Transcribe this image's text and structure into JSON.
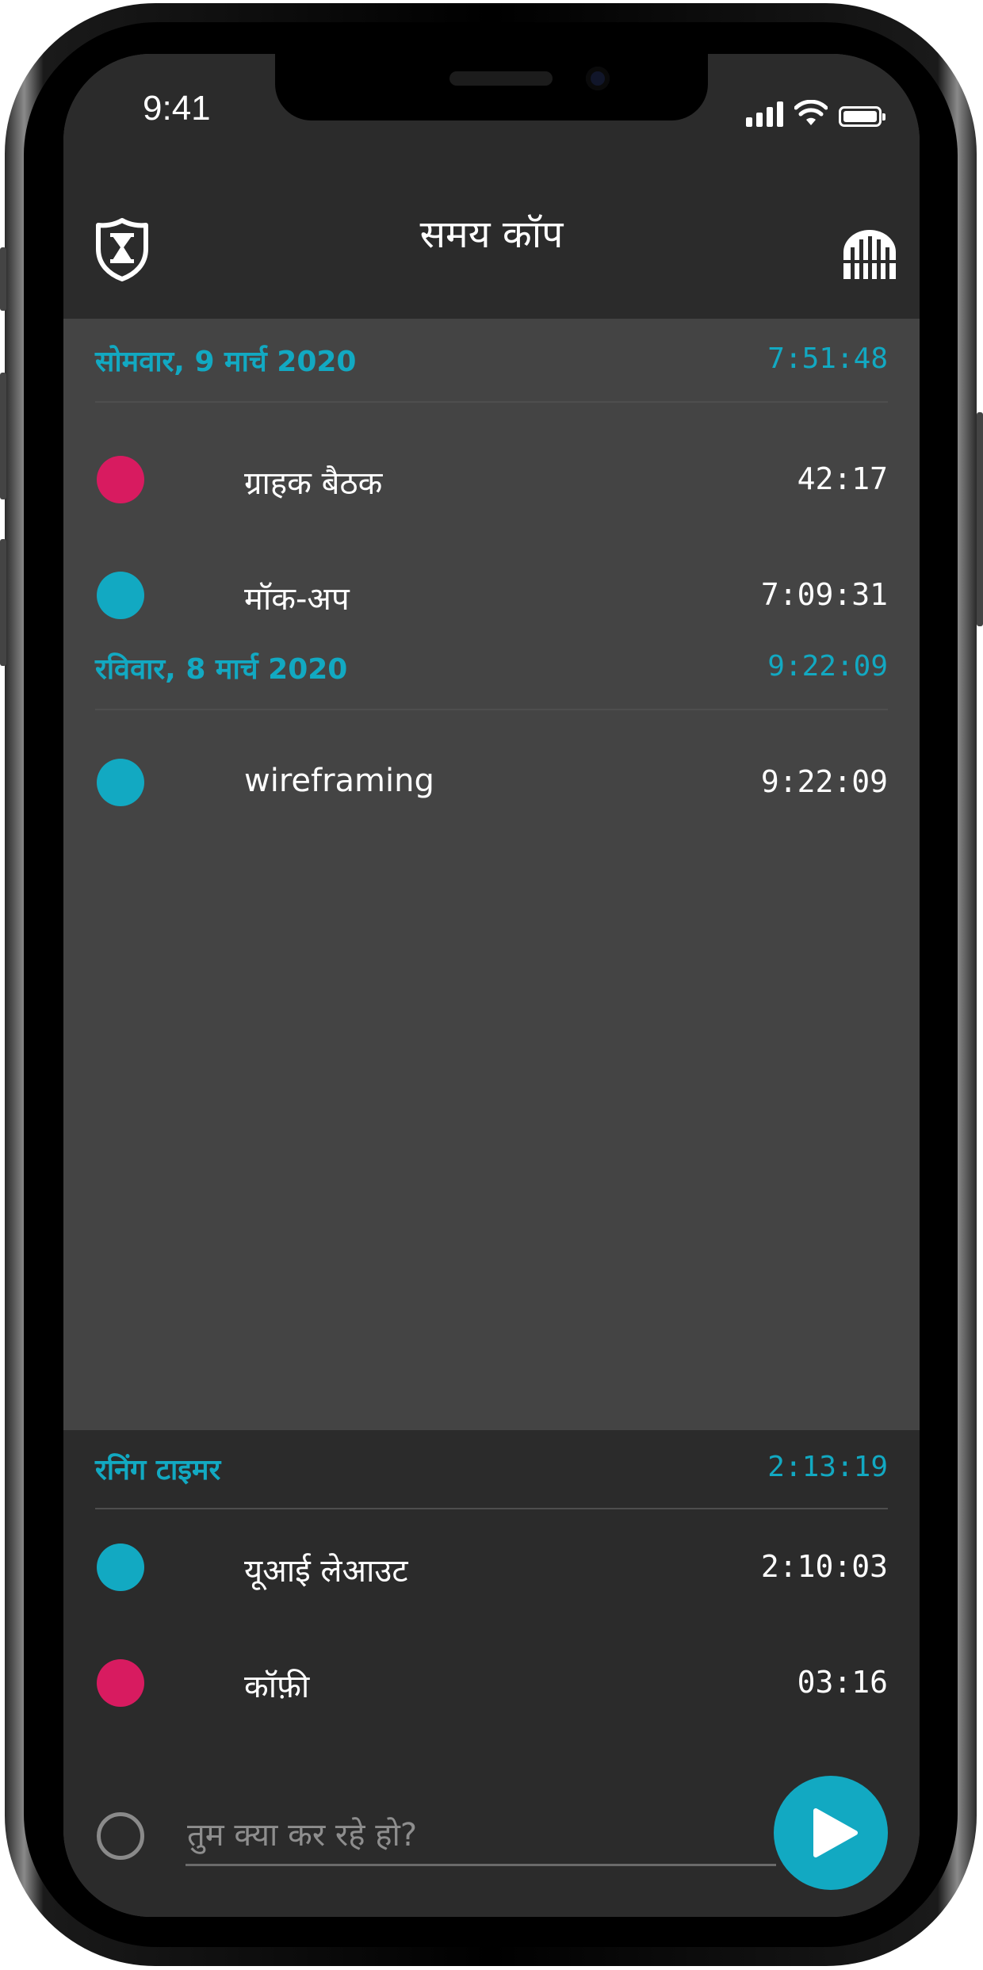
{
  "status_bar": {
    "time": "9:41"
  },
  "header": {
    "title": "समय कॉप",
    "logo_icon": "shield-hourglass-icon",
    "menu_icon": "gate-icon"
  },
  "days": [
    {
      "label": "सोमवार, 9 मार्च 2020",
      "total": "7:51:48",
      "entries": [
        {
          "name": "ग्राहक बैठक",
          "time": "42:17",
          "color": "#d81b60"
        },
        {
          "name": "मॉक-अप",
          "time": "7:09:31",
          "color": "#12a9c2"
        }
      ]
    },
    {
      "label": "रविवार, 8 मार्च 2020",
      "total": "9:22:09",
      "entries": [
        {
          "name": "wireframing",
          "time": "9:22:09",
          "color": "#12a9c2"
        }
      ]
    }
  ],
  "running": {
    "label": "रनिंग टाइमर",
    "total": "2:13:19",
    "entries": [
      {
        "name": "यूआई लेआउट",
        "time": "2:10:03",
        "color": "#12a9c2"
      },
      {
        "name": "कॉफ़ी",
        "time": "03:16",
        "color": "#d81b60"
      }
    ]
  },
  "new_task": {
    "placeholder": "तुम क्या कर रहे हो?",
    "value": "",
    "play_icon": "play-icon"
  },
  "colors": {
    "accent": "#12a9c2",
    "pink": "#d81b60",
    "header_bg": "#2b2b2b",
    "list_bg": "#444444"
  }
}
